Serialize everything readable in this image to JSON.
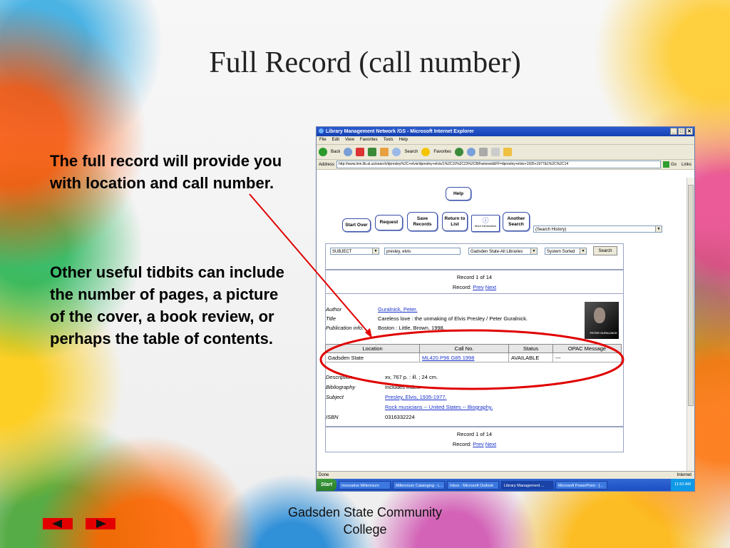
{
  "slide": {
    "title": "Full Record (call number)",
    "bullet1": "The full record will provide you with location and call number.",
    "bullet2": "Other useful tidbits can include the number of pages, a picture of the cover, a book review, or perhaps the table of contents.",
    "footer": "Gadsden State Community College"
  },
  "browser": {
    "title": "Library Management Network /GS - Microsoft Internet Explorer",
    "menu": [
      "File",
      "Edit",
      "View",
      "Favorites",
      "Tools",
      "Help"
    ],
    "toolbar": {
      "back": "Back",
      "search": "Search",
      "favorites": "Favorites"
    },
    "address_label": "Address",
    "address": "http://www.lmn.lib.al.us/search/dpresley%2C+elvis/dpresley+elvis/1%2C10%2C23%2CB/frameset&FF=dpresley+elvis+1935+1977&1%2C%2C14",
    "go": "Go",
    "links": "Links",
    "status": "Done",
    "zone": "Internet"
  },
  "opac": {
    "help": "Help",
    "buttons": [
      "Start Over",
      "Request",
      "Save Records",
      "Return to List",
      "More Information",
      "Another Search"
    ],
    "search_history": "(Search History)",
    "search_type": "SUBJECT",
    "search_term": "presley, elvis",
    "library": "Gadsden State-All Libraries",
    "sort": "System Sorted",
    "search_button": "Search",
    "record_nav": {
      "count": "Record 1 of 14",
      "label": "Record:",
      "prev": "Prev",
      "next": "Next"
    },
    "author_label": "Author",
    "author": "Guralnick, Peter.",
    "title_label": "Title",
    "title": "Careless love : the unmaking of Elvis Presley / Peter Guralnick.",
    "pub_label": "Publication info.",
    "pub": "Boston : Little, Brown, 1998.",
    "cover_text": "PETER GURALNICK",
    "holdings_headers": [
      "Location",
      "Call No.",
      "Status",
      "OPAC Message"
    ],
    "holdings_row": {
      "location": "Gadsden State",
      "call_no": "ML420.P96 G85 1998",
      "status": "AVAILABLE",
      "message": "---"
    },
    "desc_label": "Description",
    "desc": "xv, 767 p. : ill. ; 24 cm.",
    "bib_label": "Bibliography",
    "bib": "Includes index.",
    "subject_label": "Subject",
    "subject1": "Presley, Elvis, 1935-1977.",
    "subject2": "Rock musicians -- United States -- Biography.",
    "isbn_label": "ISBN",
    "isbn": "0316332224"
  },
  "taskbar": {
    "start": "Start",
    "tasks": [
      "Innovative Millennium",
      "Millennium Cataloging - L...",
      "Inbox - Microsoft Outlook",
      "Library Management ...",
      "Microsoft PowerPoint - [..."
    ],
    "clock": "11:52 AM"
  },
  "colors": {
    "annotation": "#e00000",
    "link": "#1a33cc",
    "nav": "#e30000"
  }
}
